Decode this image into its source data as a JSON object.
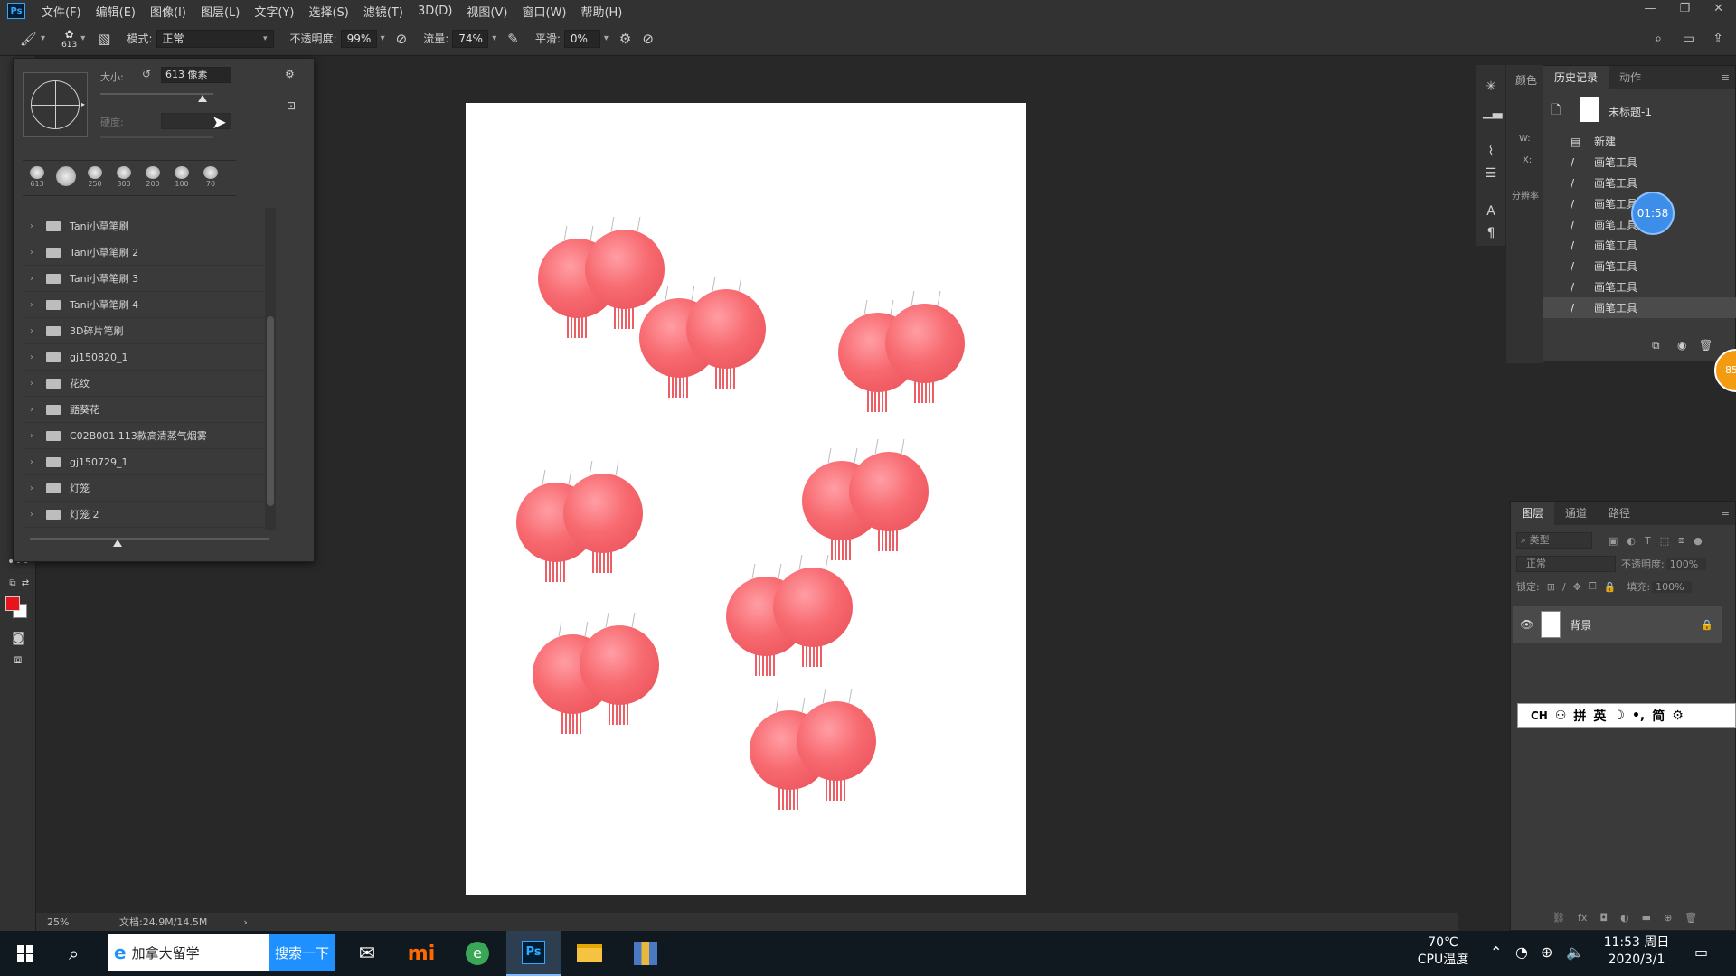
{
  "menubar": {
    "items": [
      "文件(F)",
      "编辑(E)",
      "图像(I)",
      "图层(L)",
      "文字(Y)",
      "选择(S)",
      "滤镜(T)",
      "3D(D)",
      "视图(V)",
      "窗口(W)",
      "帮助(H)"
    ],
    "logo": "Ps"
  },
  "options": {
    "brush_size_badge": "613",
    "mode_label": "模式:",
    "mode_value": "正常",
    "opacity_label": "不透明度:",
    "opacity_value": "99%",
    "flow_label": "流量:",
    "flow_value": "74%",
    "smooth_label": "平滑:",
    "smooth_value": "0%"
  },
  "brush_popup": {
    "size_label": "大小:",
    "size_value": "613 像素",
    "hardness_label": "硬度:",
    "size_fraction": 0.9,
    "recent_brushes": [
      "613",
      "",
      "250",
      "300",
      "200",
      "100",
      "70"
    ],
    "folders": [
      "Tani小草笔刷",
      "Tani小草笔刷 2",
      "Tani小草笔刷 3",
      "Tani小草笔刷 4",
      "3D碎片笔刷",
      "gj150820_1",
      "花纹",
      "鼯葵花",
      "C02B001 113款高清蒸气烟雾",
      "gj150729_1",
      "灯笼",
      "灯笼 2"
    ]
  },
  "status": {
    "zoom": "25%",
    "doc": "文档:24.9M/14.5M"
  },
  "history": {
    "tabs": [
      "颜色",
      "历史记录",
      "动作"
    ],
    "active_tab": "历史记录",
    "snapshot_name": "未标题-1",
    "items": [
      "新建",
      "画笔工具",
      "画笔工具",
      "画笔工具",
      "画笔工具",
      "画笔工具",
      "画笔工具",
      "画笔工具",
      "画笔工具"
    ],
    "timer": "01:58",
    "badge": "85"
  },
  "props_strip": {
    "w_label": "W:",
    "x_label": "X:",
    "res_label": "分辨率"
  },
  "layers": {
    "tabs": [
      "图层",
      "通道",
      "路径"
    ],
    "filter_placeholder": "类型",
    "blend_mode": "正常",
    "opacity_label": "不透明度:",
    "opacity_value": "100%",
    "lock_label": "锁定:",
    "fill_label": "填充:",
    "fill_value": "100%",
    "layer_name": "背景"
  },
  "ime": {
    "items": [
      "CH",
      "拼",
      "英",
      "简"
    ]
  },
  "taskbar": {
    "search_text": "加拿大留学",
    "search_button": "搜索一下",
    "temp": "70℃",
    "temp_label": "CPU温度",
    "time": "11:53 周日",
    "date": "2020/3/1"
  }
}
